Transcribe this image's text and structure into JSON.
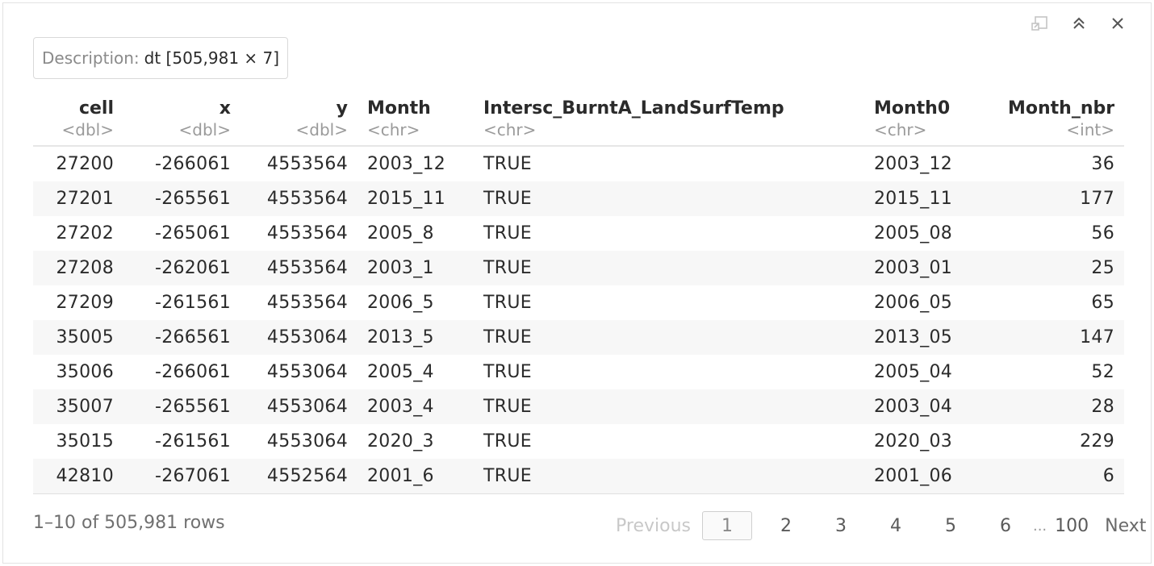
{
  "toolbar": {
    "icons": [
      "popout-icon",
      "collapse-icon",
      "close-icon"
    ]
  },
  "description": {
    "label": "Description:",
    "value": "dt [505,981 × 7]"
  },
  "table": {
    "columns": [
      {
        "name": "cell",
        "type": "<dbl>"
      },
      {
        "name": "x",
        "type": "<dbl>"
      },
      {
        "name": "y",
        "type": "<dbl>"
      },
      {
        "name": "Month",
        "type": "<chr>"
      },
      {
        "name": "Intersc_BurntA_LandSurfTemp",
        "type": "<chr>"
      },
      {
        "name": "Month0",
        "type": "<chr>"
      },
      {
        "name": "Month_nbr",
        "type": "<int>"
      }
    ],
    "rows": [
      [
        "27200",
        "-266061",
        "4553564",
        "2003_12",
        "TRUE",
        "2003_12",
        "36"
      ],
      [
        "27201",
        "-265561",
        "4553564",
        "2015_11",
        "TRUE",
        "2015_11",
        "177"
      ],
      [
        "27202",
        "-265061",
        "4553564",
        "2005_8",
        "TRUE",
        "2005_08",
        "56"
      ],
      [
        "27208",
        "-262061",
        "4553564",
        "2003_1",
        "TRUE",
        "2003_01",
        "25"
      ],
      [
        "27209",
        "-261561",
        "4553564",
        "2006_5",
        "TRUE",
        "2006_05",
        "65"
      ],
      [
        "35005",
        "-266561",
        "4553064",
        "2013_5",
        "TRUE",
        "2013_05",
        "147"
      ],
      [
        "35006",
        "-266061",
        "4553064",
        "2005_4",
        "TRUE",
        "2005_04",
        "52"
      ],
      [
        "35007",
        "-265561",
        "4553064",
        "2003_4",
        "TRUE",
        "2003_04",
        "28"
      ],
      [
        "35015",
        "-261561",
        "4553064",
        "2020_3",
        "TRUE",
        "2020_03",
        "229"
      ],
      [
        "42810",
        "-267061",
        "4552564",
        "2001_6",
        "TRUE",
        "2001_06",
        "6"
      ]
    ]
  },
  "footer": {
    "rows_info": "1–10 of 505,981 rows"
  },
  "pagination": {
    "previous": "Previous",
    "current": "1",
    "pages": [
      "2",
      "3",
      "4",
      "5",
      "6"
    ],
    "ellipsis": "...",
    "last": "100",
    "next": "Next"
  }
}
